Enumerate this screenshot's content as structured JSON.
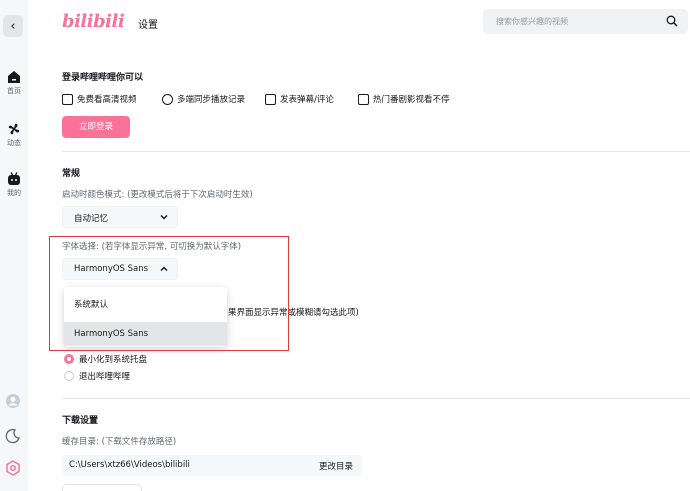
{
  "header": {
    "logo": "bilibili",
    "title": "设置",
    "search_placeholder": "搜索你感兴趣的视频"
  },
  "sidebar": {
    "items": [
      {
        "label": "首页",
        "icon": "home-icon"
      },
      {
        "label": "动态",
        "icon": "fan-icon"
      },
      {
        "label": "我的",
        "icon": "tv-icon"
      }
    ]
  },
  "login": {
    "title": "登录哔哩哔哩你可以",
    "features": [
      "免费看高清视频",
      "多端同步播放记录",
      "发表弹幕/评论",
      "热门番剧影视看不停"
    ],
    "button": "立即登录"
  },
  "general": {
    "title": "常规",
    "color_mode_label": "启动时颜色模式: (更改模式后将于下次启动时生效)",
    "color_mode_value": "自动记忆",
    "font_label": "字体选择: (若字体显示异常, 可切换为默认字体)",
    "font_value": "HarmonyOS Sans",
    "font_options": [
      "系统默认",
      "HarmonyOS Sans"
    ],
    "hidden_hint": "果界面显示异常或模糊请勾选此项)",
    "close_options": [
      "最小化到系统托盘",
      "退出哔哩哔哩"
    ]
  },
  "download": {
    "title": "下载设置",
    "cache_label": "缓存目录: (下载文件存放路径)",
    "cache_path": "C:\\Users\\xtz66\\Videos\\bilibili",
    "change_button": "更改目录"
  },
  "colors": {
    "accent": "#fb7299",
    "highlight": "#e03a3a"
  }
}
